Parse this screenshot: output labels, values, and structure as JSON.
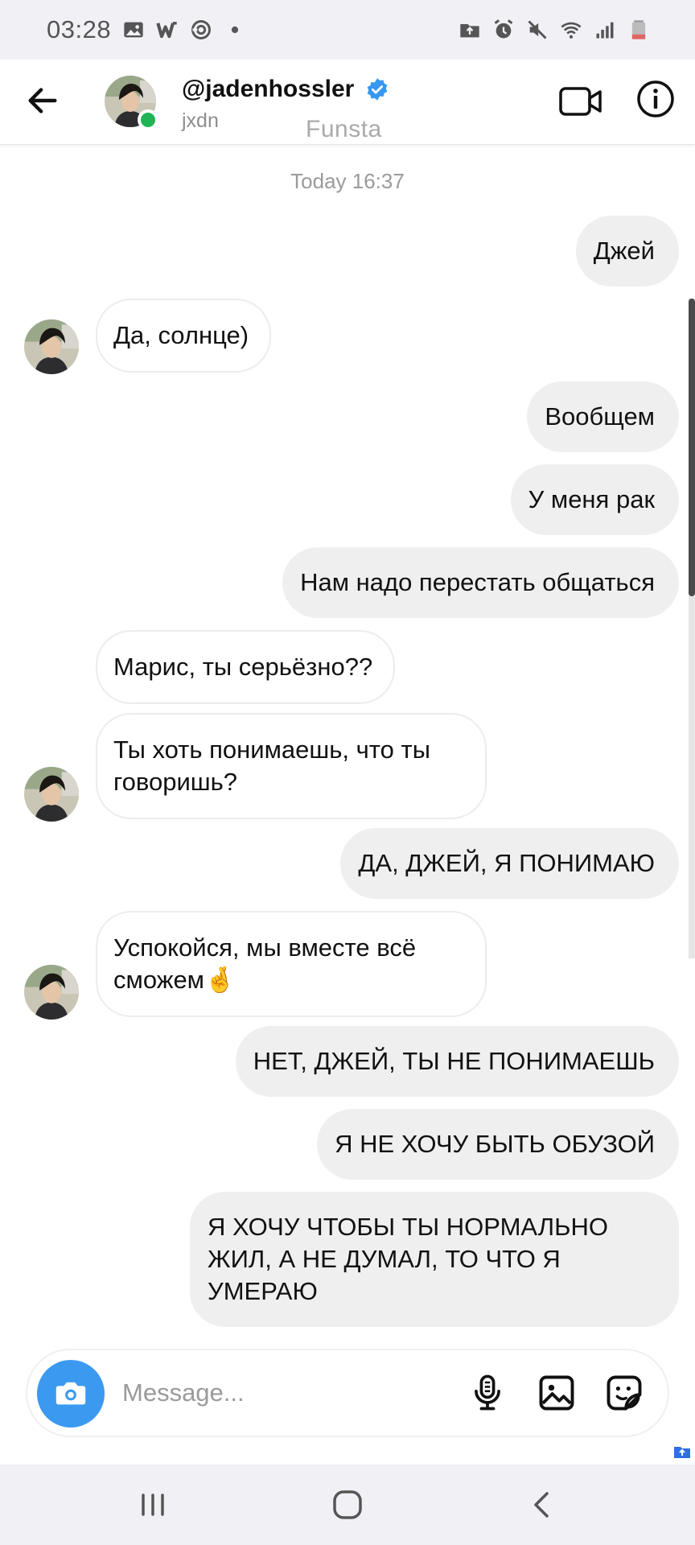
{
  "status_bar": {
    "time": "03:28",
    "left_icons": [
      "image-icon",
      "w-app-icon",
      "swirl-icon",
      "dot-icon"
    ],
    "right_icons": [
      "folder-icon",
      "alarm-icon",
      "mute-icon",
      "wifi-icon",
      "signal-icon",
      "battery-icon"
    ]
  },
  "header": {
    "username": "@jadenhossler",
    "subtitle": "jxdn",
    "overlay_text": "Funsta",
    "verified_color": "#3897f0",
    "online_color": "#20b456"
  },
  "chat": {
    "date_separator": "Today 16:37",
    "messages": [
      {
        "side": "out",
        "text": "Джей"
      },
      {
        "side": "in",
        "text": "Да, солнце)"
      },
      {
        "side": "out",
        "text": "Вообщем"
      },
      {
        "side": "out",
        "text": "У меня рак"
      },
      {
        "side": "out",
        "text": "Нам надо перестать общаться"
      },
      {
        "side": "in",
        "text": "Марис, ты серьёзно??"
      },
      {
        "side": "in",
        "text": "Ты хоть понимаешь, что ты говоришь?"
      },
      {
        "side": "out",
        "text": "ДА, ДЖЕЙ, Я ПОНИМАЮ"
      },
      {
        "side": "in",
        "text": "Успокойся, мы вместе всё сможем🤞"
      },
      {
        "side": "out",
        "text": "НЕТ, ДЖЕЙ, ТЫ НЕ ПОНИМАЕШЬ"
      },
      {
        "side": "out",
        "text": "Я НЕ ХОЧУ БЫТЬ ОБУЗОЙ"
      },
      {
        "side": "out",
        "text": "Я ХОЧУ ЧТОБЫ ТЫ НОРМАЛЬНО ЖИЛ, А НЕ ДУМАЛ, ТО ЧТО Я УМЕРАЮ"
      }
    ]
  },
  "composer": {
    "placeholder": "Message...",
    "camera_color": "#3b9af0",
    "icons": [
      "microphone-icon",
      "gallery-icon",
      "sticker-icon"
    ]
  },
  "nav_bar": {
    "buttons": [
      "recent-apps-icon",
      "home-icon",
      "back-icon"
    ]
  }
}
